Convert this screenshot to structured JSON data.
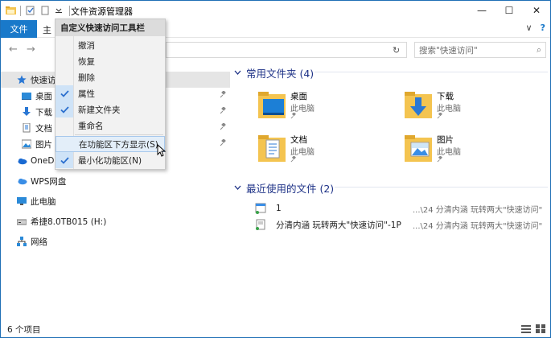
{
  "window": {
    "title": "文件资源管理器",
    "controls": {
      "minimize": "—",
      "maximize": "☐",
      "close": "✕"
    }
  },
  "ribbon": {
    "file_tab": "文件",
    "home_tab": "主",
    "expand_icon": "∨",
    "help_icon": "?"
  },
  "address": {
    "back": "←",
    "forward": "→",
    "refresh": "↻",
    "search_placeholder": "搜索\"快速访问\"",
    "search_icon": "⌕"
  },
  "nav": {
    "quick_access": "快速访问",
    "pinned": [
      {
        "label": "桌面",
        "icon": "desktop-icon"
      },
      {
        "label": "下载",
        "icon": "download-icon"
      },
      {
        "label": "文档",
        "icon": "documents-icon"
      },
      {
        "label": "图片",
        "icon": "pictures-icon"
      }
    ],
    "onedrive": "OneDr",
    "wps": "WPS网盘",
    "this_pc": "此电脑",
    "drive": "希捷8.0TB015 (H:)",
    "network": "网络",
    "pin_glyph": "📌"
  },
  "content": {
    "frequent_header": "常用文件夹 (4)",
    "frequent": [
      {
        "name": "桌面",
        "location": "此电脑",
        "icon": "desktop-folder-icon"
      },
      {
        "name": "下载",
        "location": "此电脑",
        "icon": "download-folder-icon"
      },
      {
        "name": "文档",
        "location": "此电脑",
        "icon": "documents-folder-icon"
      },
      {
        "name": "图片",
        "location": "此电脑",
        "icon": "pictures-folder-icon"
      }
    ],
    "recent_header": "最近使用的文件 (2)",
    "recent": [
      {
        "name": "1",
        "path": "...\\24 分清内涵  玩转两大\"快速访问\""
      },
      {
        "name": "分清内涵  玩转两大\"快速访问\"-1P",
        "path": "...\\24 分清内涵  玩转两大\"快速访问\""
      }
    ]
  },
  "menu": {
    "title": "自定义快速访问工具栏",
    "items": [
      {
        "label": "撤消",
        "checked": false
      },
      {
        "label": "恢复",
        "checked": false
      },
      {
        "label": "删除",
        "checked": false
      },
      {
        "label": "属性",
        "checked": true
      },
      {
        "label": "新建文件夹",
        "checked": true
      },
      {
        "label": "重命名",
        "checked": false
      },
      {
        "label": "在功能区下方显示(S)",
        "checked": false
      },
      {
        "label": "最小化功能区(N)",
        "checked": true
      }
    ]
  },
  "status": {
    "count": "6 个项目"
  },
  "colors": {
    "accent": "#1979ca",
    "header_text": "#1e3287",
    "folder": "#f4c450"
  }
}
